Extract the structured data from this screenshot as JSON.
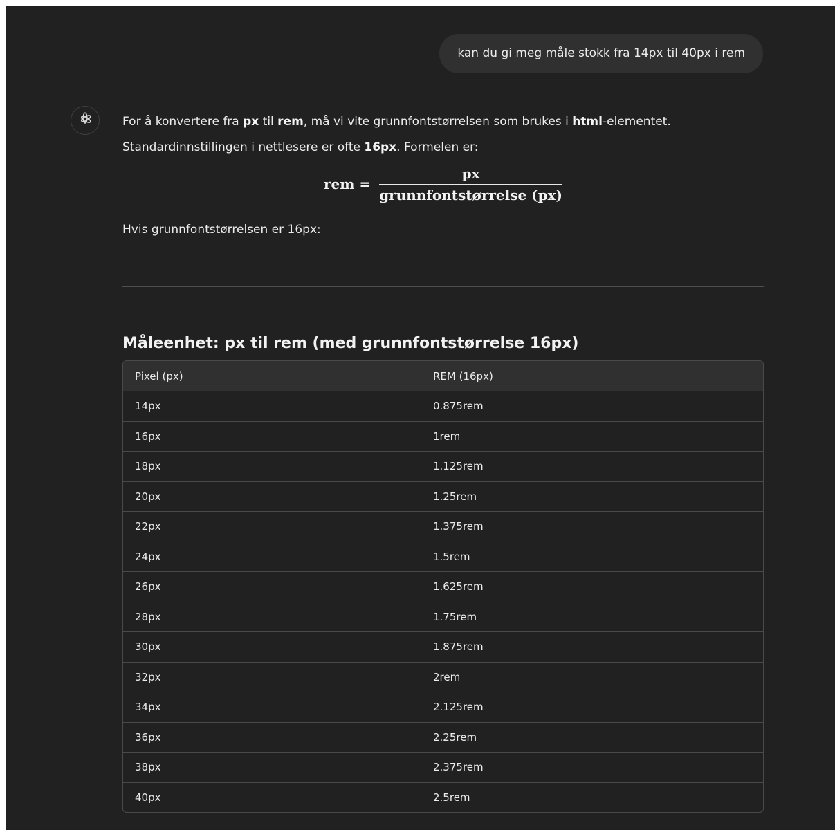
{
  "user_message": "kan du gi meg måle stokk fra 14px til 40px i rem",
  "assistant": {
    "avatar_icon": "openai-logo-icon",
    "intro": {
      "t1": "For å konvertere fra ",
      "b1": "px",
      "t2": " til ",
      "b2": "rem",
      "t3": ", må vi vite grunnfontstørrelsen som brukes i ",
      "b3": "html",
      "t4": "-elementet.",
      "t5": "Standardinnstillingen i nettlesere er ofte ",
      "b4": "16px",
      "t6": ". Formelen er:"
    },
    "formula": {
      "lhs": "rem =",
      "numerator": "px",
      "denominator": "grunnfontstørrelse (px)"
    },
    "condition": "Hvis grunnfontstørrelsen er 16px:",
    "table_title": "Måleenhet: px til rem (med grunnfontstørrelse 16px)",
    "table": {
      "headers": [
        "Pixel (px)",
        "REM (16px)"
      ],
      "rows": [
        [
          "14px",
          "0.875rem"
        ],
        [
          "16px",
          "1rem"
        ],
        [
          "18px",
          "1.125rem"
        ],
        [
          "20px",
          "1.25rem"
        ],
        [
          "22px",
          "1.375rem"
        ],
        [
          "24px",
          "1.5rem"
        ],
        [
          "26px",
          "1.625rem"
        ],
        [
          "28px",
          "1.75rem"
        ],
        [
          "30px",
          "1.875rem"
        ],
        [
          "32px",
          "2rem"
        ],
        [
          "34px",
          "2.125rem"
        ],
        [
          "36px",
          "2.25rem"
        ],
        [
          "38px",
          "2.375rem"
        ],
        [
          "40px",
          "2.5rem"
        ]
      ]
    }
  },
  "colors": {
    "background": "#212121",
    "bubble": "#303030",
    "text": "#ececec",
    "border": "#4a4a4a"
  }
}
